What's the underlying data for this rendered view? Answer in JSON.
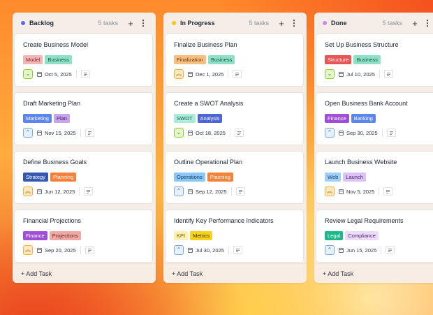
{
  "columns": [
    {
      "title": "Backlog",
      "dot_color": "#5b6cf2",
      "count": "5 tasks",
      "add_label": "+ Add Task",
      "cards": [
        {
          "title": "Create Business Model",
          "tags": [
            {
              "label": "Model",
              "bg": "#f4b5b5",
              "fg": "#7a2b2b"
            },
            {
              "label": "Business",
              "bg": "#8fe0c4",
              "fg": "#12584a"
            }
          ],
          "priority": "low",
          "date": "Oct 5, 2025"
        },
        {
          "title": "Draft Marketing Plan",
          "tags": [
            {
              "label": "Marketing",
              "bg": "#5c86ee",
              "fg": "#ffffff"
            },
            {
              "label": "Plan",
              "bg": "#c7a4ec",
              "fg": "#41205e"
            }
          ],
          "priority": "medium",
          "date": "Nov 15, 2025"
        },
        {
          "title": "Define Business Goals",
          "tags": [
            {
              "label": "Strategy",
              "bg": "#3559b2",
              "fg": "#ffffff"
            },
            {
              "label": "Planning",
              "bg": "#f5813a",
              "fg": "#ffffff"
            }
          ],
          "priority": "high",
          "date": "Jun 12, 2025"
        },
        {
          "title": "Financial Projections",
          "tags": [
            {
              "label": "Finance",
              "bg": "#9f4fd9",
              "fg": "#ffffff"
            },
            {
              "label": "Projections",
              "bg": "#f0aaa5",
              "fg": "#6a2622"
            }
          ],
          "priority": "high",
          "date": "Sep 20, 2025"
        }
      ]
    },
    {
      "title": "In Progress",
      "dot_color": "#f5c518",
      "count": "5 tasks",
      "add_label": "+ Add Task",
      "cards": [
        {
          "title": "Finalize Business Plan",
          "tags": [
            {
              "label": "Finalization",
              "bg": "#f7bf82",
              "fg": "#6a3a0b"
            },
            {
              "label": "Business",
              "bg": "#8fe0c4",
              "fg": "#12584a"
            }
          ],
          "priority": "high",
          "date": "Dec 1, 2025"
        },
        {
          "title": "Create a SWOT Analysis",
          "tags": [
            {
              "label": "SWOT",
              "bg": "#a9ecd8",
              "fg": "#1a5a4a"
            },
            {
              "label": "Analysis",
              "bg": "#4c66d6",
              "fg": "#ffffff"
            }
          ],
          "priority": "low",
          "date": "Oct 18, 2025"
        },
        {
          "title": "Outline Operational Plan",
          "tags": [
            {
              "label": "Operations",
              "bg": "#8cc6f4",
              "fg": "#14406a"
            },
            {
              "label": "Planning",
              "bg": "#f5813a",
              "fg": "#ffffff"
            }
          ],
          "priority": "medium",
          "date": "Sep 12, 2025"
        },
        {
          "title": "Identify Key Performance Indicators",
          "tags": [
            {
              "label": "KPI",
              "bg": "#fdf0b0",
              "fg": "#6a5a12"
            },
            {
              "label": "Metrics",
              "bg": "#f8d21c",
              "fg": "#3d3200"
            }
          ],
          "priority": "medium",
          "date": "Jul 30, 2025"
        }
      ]
    },
    {
      "title": "Done",
      "dot_color": "#c58bf0",
      "count": "5 tasks",
      "add_label": "+ Add Task",
      "cards": [
        {
          "title": "Set Up Business Structure",
          "tags": [
            {
              "label": "Structure",
              "bg": "#e85555",
              "fg": "#ffffff"
            },
            {
              "label": "Business",
              "bg": "#8fe0c4",
              "fg": "#12584a"
            }
          ],
          "priority": "low",
          "date": "Jul 10, 2025"
        },
        {
          "title": "Open Business Bank Account",
          "tags": [
            {
              "label": "Finance",
              "bg": "#9f4fd9",
              "fg": "#ffffff"
            },
            {
              "label": "Banking",
              "bg": "#5c86ee",
              "fg": "#ffffff"
            }
          ],
          "priority": "medium",
          "date": "Sep 30, 2025"
        },
        {
          "title": "Launch Business Website",
          "tags": [
            {
              "label": "Web",
              "bg": "#9fd0f7",
              "fg": "#14406a"
            },
            {
              "label": "Launch",
              "bg": "#dcc3f6",
              "fg": "#4a2370"
            }
          ],
          "priority": "high",
          "date": "Nov 5, 2025"
        },
        {
          "title": "Review Legal Requirements",
          "tags": [
            {
              "label": "Legal",
              "bg": "#1fb88a",
              "fg": "#ffffff"
            },
            {
              "label": "Compliance",
              "bg": "#ecdcf7",
              "fg": "#4a2370"
            }
          ],
          "priority": "medium",
          "date": "Jun 15, 2025"
        }
      ]
    }
  ],
  "priority_styles": {
    "low": {
      "icon": "chevron-down-icon",
      "glyph": "⌄",
      "bg": "#e3f7c9",
      "border": "#8dcc4a",
      "fg": "#4c8a12"
    },
    "medium": {
      "icon": "chevron-up-icon",
      "glyph": "⌃",
      "bg": "#e6f0fb",
      "border": "#7ea9d8",
      "fg": "#3d6ea8"
    },
    "high": {
      "icon": "double-chevron-up-icon",
      "glyph": "︽",
      "bg": "#fde8bf",
      "border": "#f0b24a",
      "fg": "#b8730b"
    }
  }
}
